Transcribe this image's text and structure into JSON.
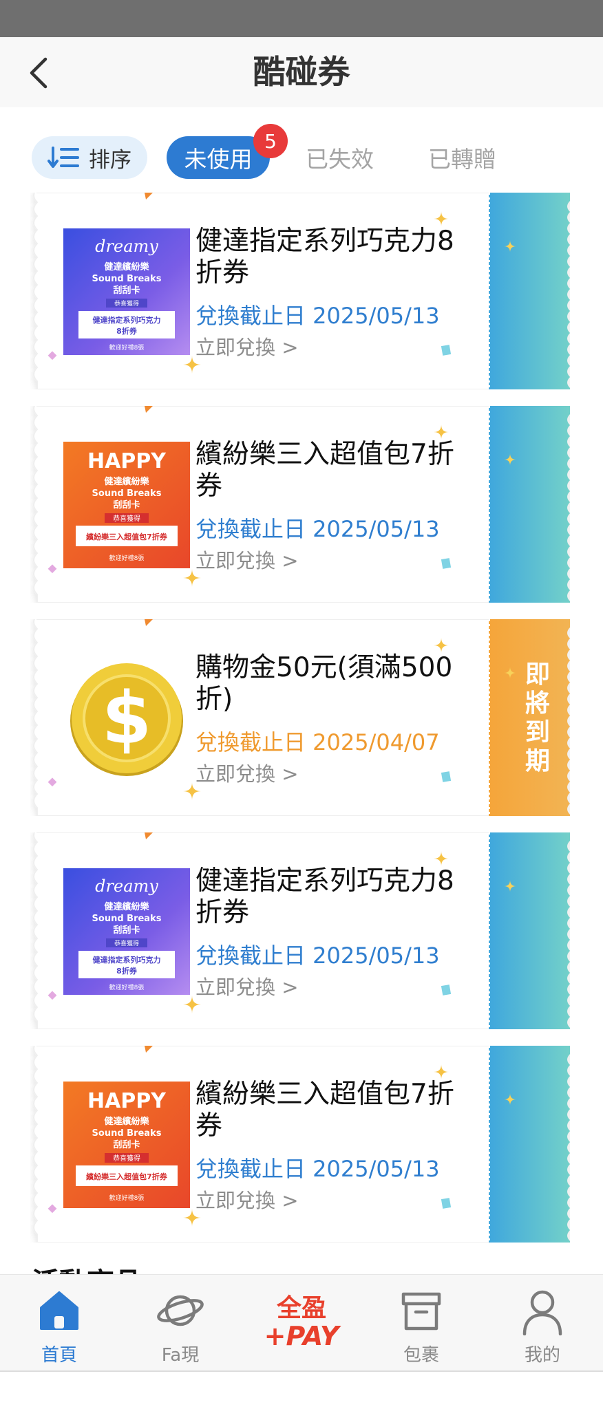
{
  "header": {
    "title": "酷碰券"
  },
  "toolbar": {
    "sort_label": "排序",
    "tabs": [
      {
        "label": "未使用",
        "badge": "5",
        "active": true
      },
      {
        "label": "已失效"
      },
      {
        "label": "已轉贈"
      }
    ]
  },
  "coupons": [
    {
      "name": "健達指定系列巧克力8折券",
      "expiry": "兌換截止日 2025/05/13",
      "redeem": "立即兌換 >",
      "image": "dreamy-card",
      "image_text": [
        "dreamy",
        "健達繽紛樂",
        "Sound Breaks",
        "刮刮卡",
        "恭喜獲得",
        "健達指定系列巧克力",
        "8折券",
        "歡迎好禮8張"
      ]
    },
    {
      "name": "繽紛樂三入超值包7折券",
      "expiry": "兌換截止日 2025/05/13",
      "redeem": "立即兌換 >",
      "image": "happy-card",
      "image_text": [
        "HAPPY",
        "健達繽紛樂",
        "Sound Breaks",
        "刮刮卡",
        "恭喜獲得",
        "繽紛樂三入超值包7折券",
        "歡迎好禮8張"
      ]
    },
    {
      "name": "購物金50元(須滿500折)",
      "expiry": "兌換截止日 2025/04/07",
      "redeem": "立即兌換 >",
      "image": "gold-coin",
      "stub_label": "即將到期",
      "expiring": true
    },
    {
      "name": "健達指定系列巧克力8折券",
      "expiry": "兌換截止日 2025/05/13",
      "redeem": "立即兌換 >",
      "image": "dreamy-card",
      "image_text": [
        "dreamy",
        "健達繽紛樂",
        "Sound Breaks",
        "刮刮卡",
        "恭喜獲得",
        "健達指定系列巧克力",
        "8折券",
        "歡迎好禮8張"
      ]
    },
    {
      "name": "繽紛樂三入超值包7折券",
      "expiry": "兌換截止日 2025/05/13",
      "redeem": "立即兌換 >",
      "image": "happy-card",
      "image_text": [
        "HAPPY",
        "健達繽紛樂",
        "Sound Breaks",
        "刮刮卡",
        "恭喜獲得",
        "繽紛樂三入超值包7折券",
        "歡迎好禮8張"
      ]
    }
  ],
  "section_peek": "活動商品",
  "bottom_nav": [
    {
      "label": "首頁",
      "icon": "home-icon",
      "active": true
    },
    {
      "label": "Fa現",
      "icon": "planet-icon"
    },
    {
      "label": "",
      "icon": "quanying-pay-logo",
      "logo_text": [
        "全盈",
        "+PAY"
      ]
    },
    {
      "label": "包裹",
      "icon": "package-icon"
    },
    {
      "label": "我的",
      "icon": "person-icon"
    }
  ],
  "colors": {
    "accent": "#2d7bd2",
    "badge": "#e83a3a",
    "expiring": "#ef9a2f",
    "stub_blue": "#3fa7dd",
    "stub_teal": "#72d0cb"
  }
}
